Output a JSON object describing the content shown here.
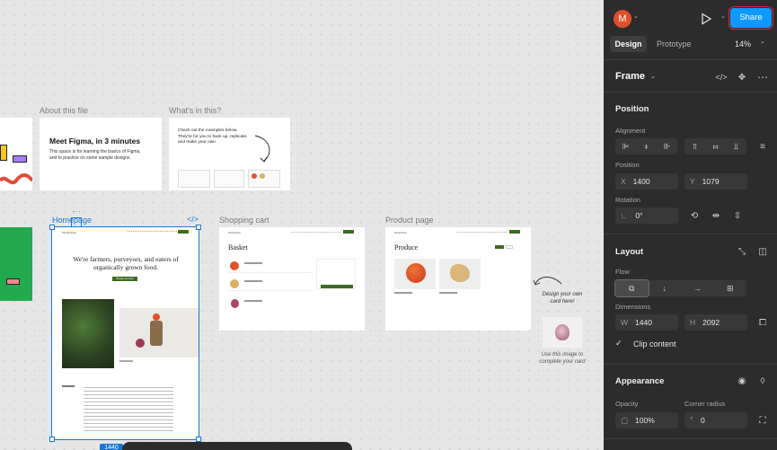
{
  "canvas": {
    "frames": {
      "about": {
        "label": "About this file",
        "heading": "Meet Figma, in 3 minutes",
        "body": "This space is for learning the basics of Figma, and to practice on some sample designs."
      },
      "whats_in": {
        "label": "What's in this?",
        "body": "Check out the examples below. They're for you to hack up, replicate, and make your own."
      },
      "homepage": {
        "label": "Homepage",
        "brand": "World Peas",
        "hero": "We're farmers, purveyors, and eaters of organically grown food.",
        "cta": "Browse our shop",
        "size_badge": "1440"
      },
      "cart": {
        "label": "Shopping cart",
        "heading": "Basket",
        "brand": "World Peas"
      },
      "product": {
        "label": "Product page",
        "heading": "Produce",
        "brand": "World Peas"
      },
      "note_design": "Design your own card here!",
      "note_image": "Use this image to complete your card"
    }
  },
  "panel": {
    "avatar_letter": "M",
    "share_label": "Share",
    "tabs": {
      "design": "Design",
      "prototype": "Prototype"
    },
    "zoom": "14%",
    "frame_title": "Frame",
    "position": {
      "title": "Position",
      "alignment_label": "Alignment",
      "position_label": "Position",
      "x_prefix": "X",
      "x": "1400",
      "y_prefix": "Y",
      "y": "1079",
      "rotation_label": "Rotation",
      "rotation": "0°"
    },
    "layout": {
      "title": "Layout",
      "flow_label": "Flow",
      "dimensions_label": "Dimensions",
      "w_prefix": "W",
      "w": "1440",
      "h_prefix": "H",
      "h": "2092",
      "clip_label": "Clip content"
    },
    "appearance": {
      "title": "Appearance",
      "opacity_label": "Opacity",
      "opacity": "100%",
      "radius_label": "Corner radius",
      "radius": "0"
    }
  }
}
